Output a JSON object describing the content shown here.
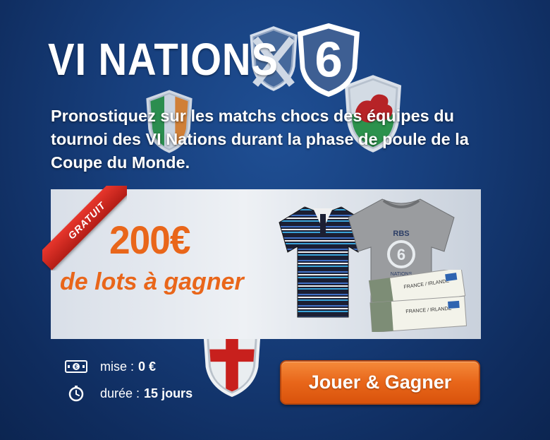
{
  "header": {
    "title": "VI NATIONS",
    "logo_number": "6"
  },
  "intro": {
    "text": "Pronostiquez sur les matchs chocs des équipes du tournoi des VI Nations durant la phase de poule de la Coupe du Monde."
  },
  "prize": {
    "ribbon": "GRATUIT",
    "amount": "200€",
    "label": "de lots à gagner",
    "tshirt_text": "RBS",
    "tshirt_caption": "NATIONS",
    "ticket_text": "FRANCE / IRLANDE"
  },
  "footer": {
    "stake_label": "mise :",
    "stake_value": "0 €",
    "duration_label": "durée :",
    "duration_value": "15 jours",
    "play_button": "Jouer & Gagner"
  },
  "colors": {
    "background": "#173f7d",
    "accent_orange": "#e9661a",
    "ribbon_red": "#d8271f"
  },
  "icons": {
    "stake": "banknote-icon",
    "duration": "stopwatch-icon"
  }
}
